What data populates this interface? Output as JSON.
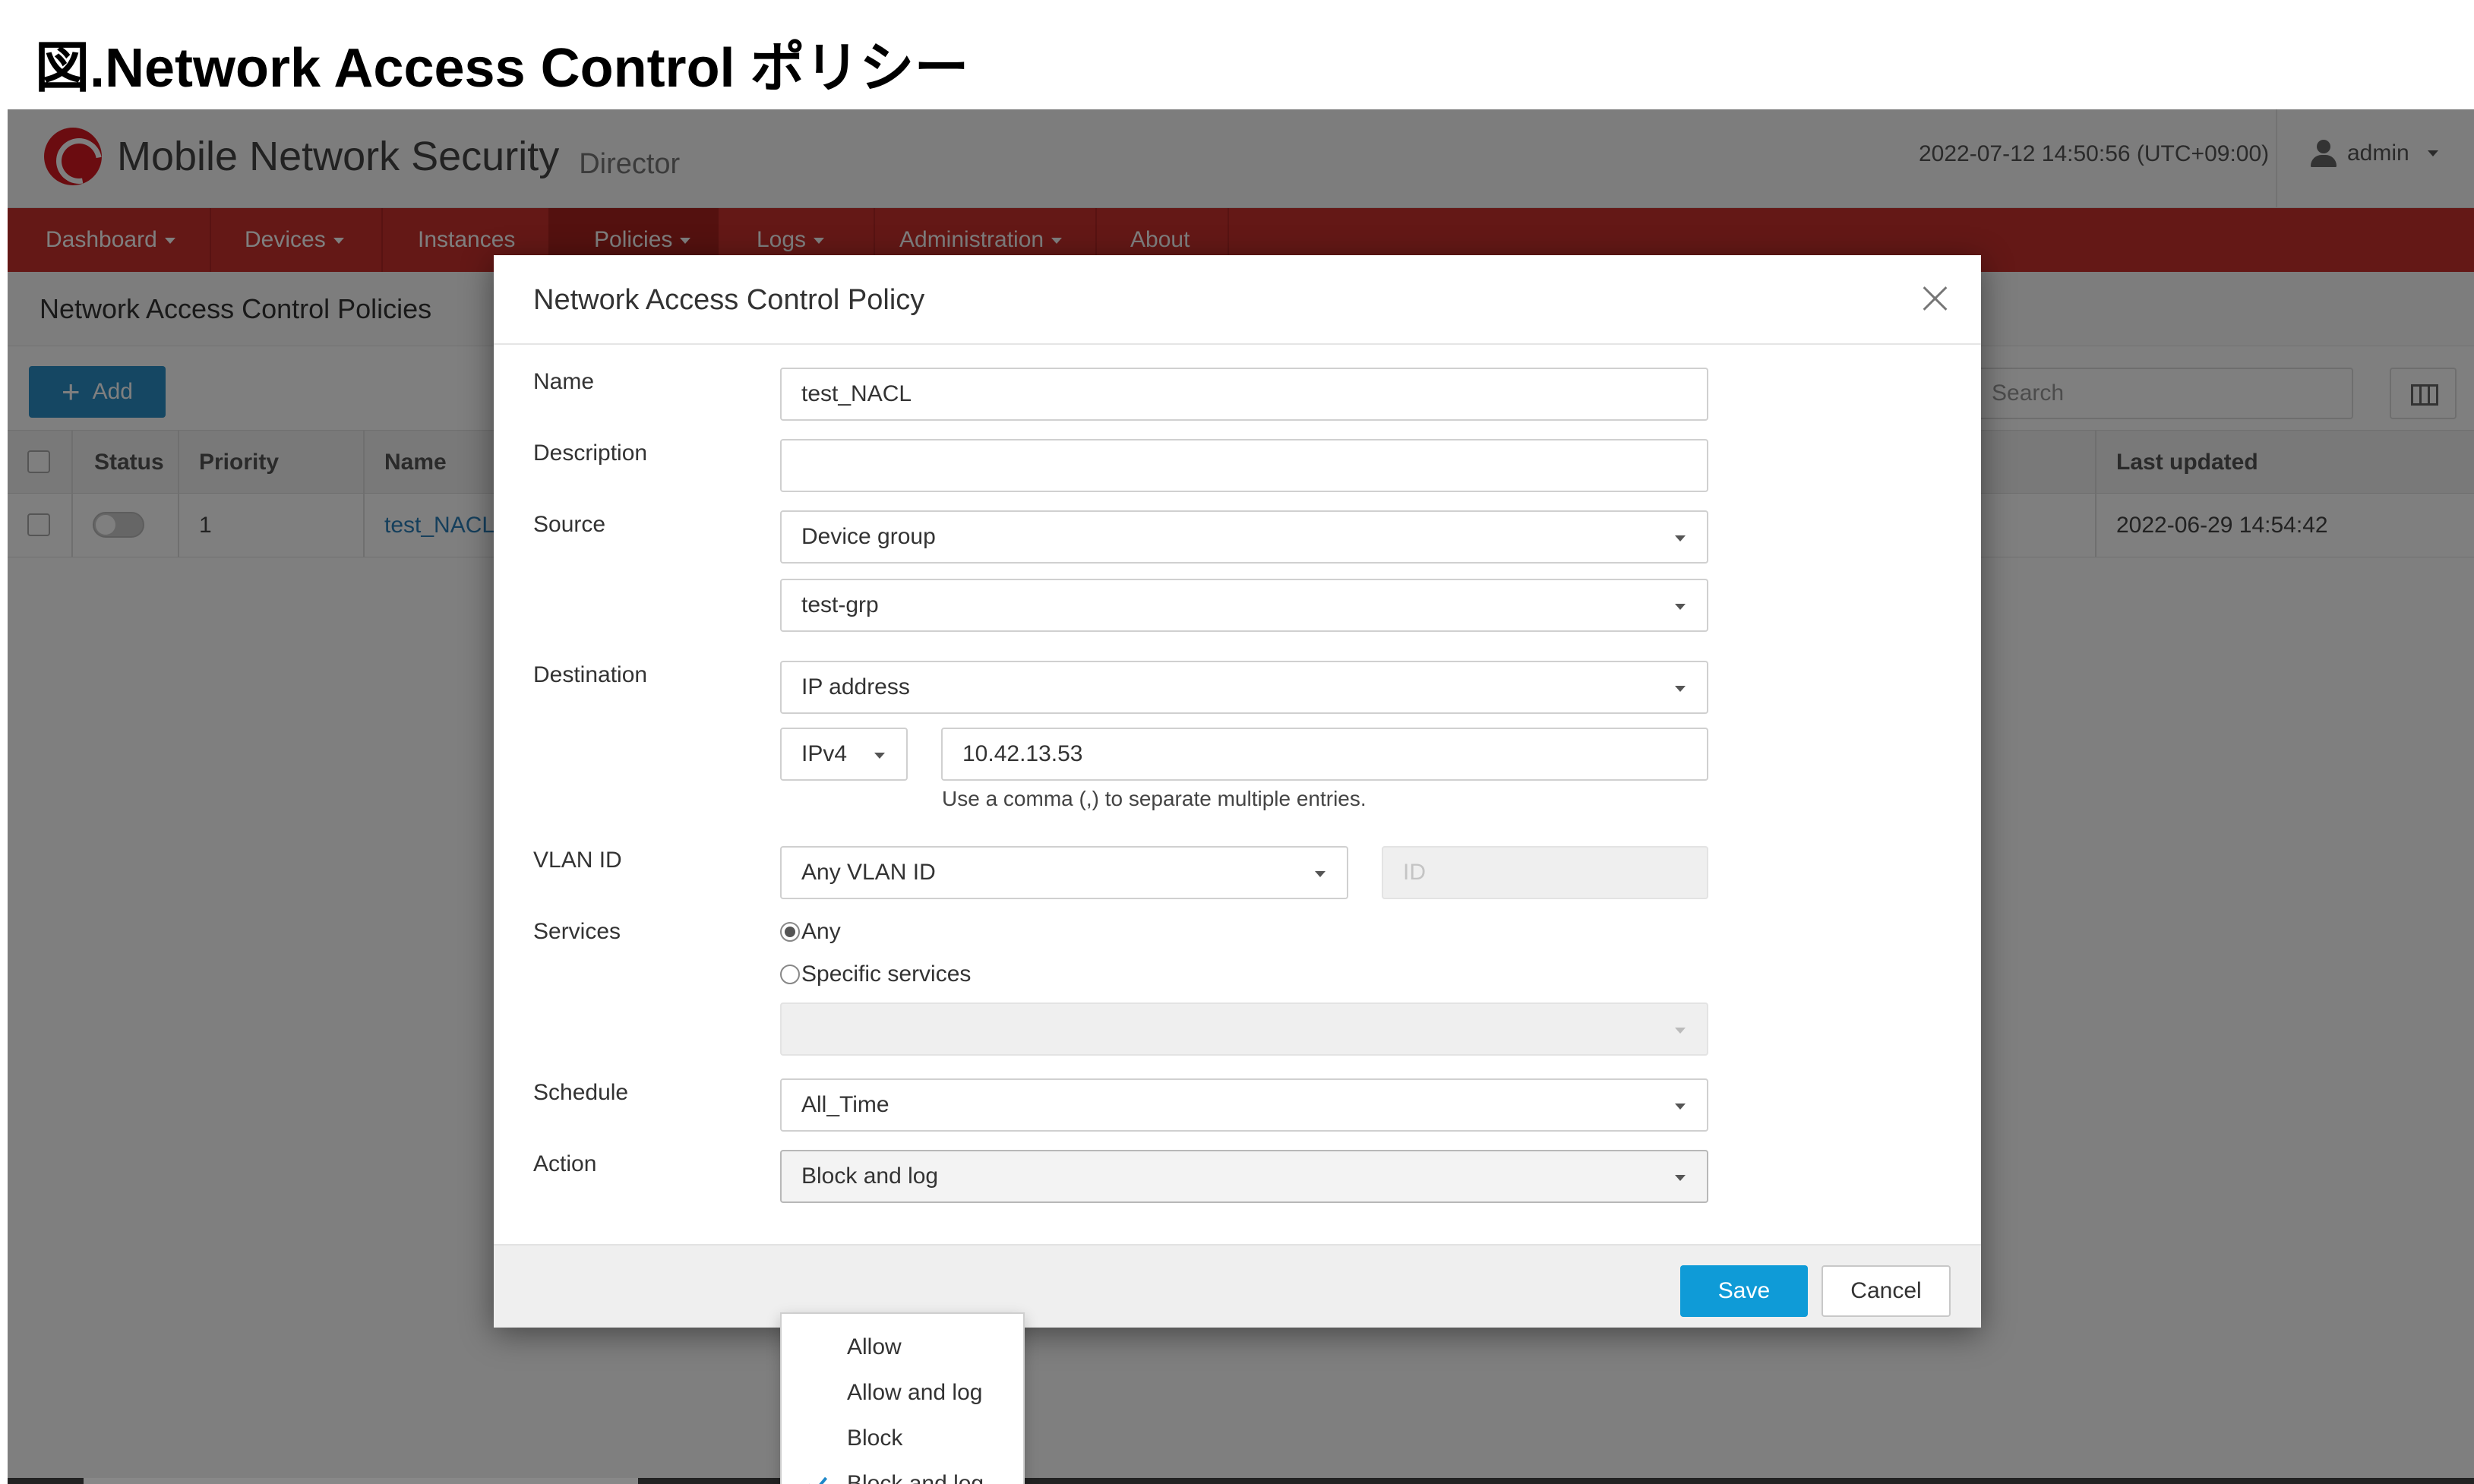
{
  "caption": "図.Network Access Control ポリシー",
  "app": {
    "brand_name": "Mobile Network Security",
    "brand_sub": "Director",
    "datetime": "2022-07-12 14:50:56 (UTC+09:00)",
    "user": "admin",
    "nav": [
      {
        "label": "Dashboard",
        "dropdown": true
      },
      {
        "label": "Devices",
        "dropdown": true
      },
      {
        "label": "Instances",
        "dropdown": false
      },
      {
        "label": "Policies",
        "dropdown": true,
        "active": true
      },
      {
        "label": "Logs",
        "dropdown": true
      },
      {
        "label": "Administration",
        "dropdown": true
      },
      {
        "label": "About",
        "dropdown": false
      }
    ],
    "page_title": "Network Access Control Policies",
    "add_label": "Add",
    "search_placeholder": "Search",
    "table": {
      "headers": [
        "Status",
        "Priority",
        "Name",
        "Last updated"
      ],
      "rows": [
        {
          "priority": "1",
          "name": "test_NACL",
          "last_updated": "2022-06-29 14:54:42",
          "enabled": false
        }
      ]
    }
  },
  "modal": {
    "title": "Network Access Control Policy",
    "labels": {
      "name": "Name",
      "description": "Description",
      "source": "Source",
      "destination": "Destination",
      "vlan": "VLAN ID",
      "services": "Services",
      "schedule": "Schedule",
      "action": "Action"
    },
    "values": {
      "name": "test_NACL",
      "description": "",
      "source_type": "Device group",
      "source_group": "test-grp",
      "destination_type": "IP address",
      "ip_version": "IPv4",
      "ip_address": "10.42.13.53",
      "ip_hint": "Use a comma (,) to separate multiple entries.",
      "vlan": "Any VLAN ID",
      "vlan_id_placeholder": "ID",
      "services_any": "Any",
      "services_specific": "Specific services",
      "services_selected": "any",
      "schedule": "All_Time",
      "action": "Block and log"
    },
    "action_options": [
      "Allow",
      "Allow and log",
      "Block",
      "Block and log"
    ],
    "action_selected_index": 3,
    "save_label": "Save",
    "cancel_label": "Cancel"
  },
  "colors": {
    "nav_red": "#c8302d",
    "primary_blue": "#0f9bd7",
    "add_blue": "#2a8fc7",
    "check_blue": "#1e88c9"
  }
}
